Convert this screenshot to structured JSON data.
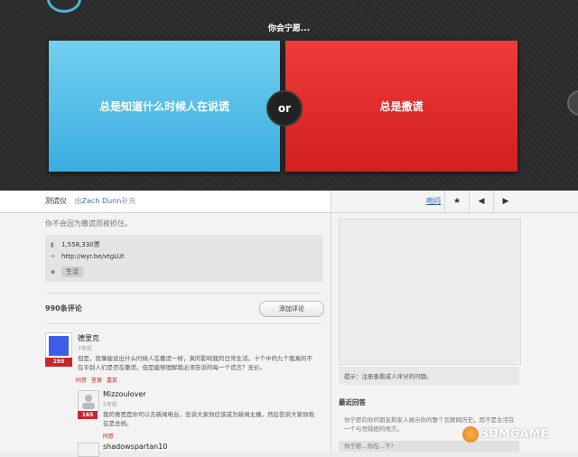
{
  "question": "你会宁愿...",
  "options": {
    "left": "总是知道什么时候人在说谎",
    "or": "or",
    "right": "总是撒谎"
  },
  "bar": {
    "tag": "测谎仪",
    "by_prefix": "由",
    "author": "Zach Dunn",
    "by_suffix": "补充",
    "link": "吻问",
    "star": "★",
    "prev": "◀",
    "next": "▶"
  },
  "main": {
    "description": "你不会因为撒谎而被抓住。",
    "views": "1,558,330票",
    "url": "http://wyr.be/vtgLUt",
    "category": "生活",
    "comments_count": "990条评论",
    "add_comment": "添加评论"
  },
  "comments": [
    {
      "name": "德里克",
      "time": "7年前",
      "score": "295",
      "lines": [
        "但是，就像能说出什么时候人在撒谎一样，真的影响我的日常生活。十个中的九个我真的不",
        "在乎别人们是否在撒谎。但是能够理解我必须告诉的每一个谎言？无价。"
      ],
      "actions": [
        "同意",
        "答复",
        "嘉奖"
      ],
      "avatar_color": "#3d5ee8"
    },
    {
      "name": "Mizzoulover",
      "time": "5年前",
      "score": "165",
      "lines": [
        "我的意思是你可以去新闻电台，告诉大家你应该成为新闻主播，然后告诉大家你现",
        "在是总统。"
      ],
      "actions": [
        "同意"
      ]
    },
    {
      "name": "shadowspartan10"
    }
  ],
  "aside": {
    "note": "提示：注册查看成人评分的问题。",
    "recent_title": "最近回答",
    "recent_1": "你宁愿向你的朋友和家人展示你的整个互联网历史，而不是生活在一个与世隔绝的地方。",
    "recent_2": "你宁愿...你在...下?"
  },
  "watermark": "3DMGAME"
}
